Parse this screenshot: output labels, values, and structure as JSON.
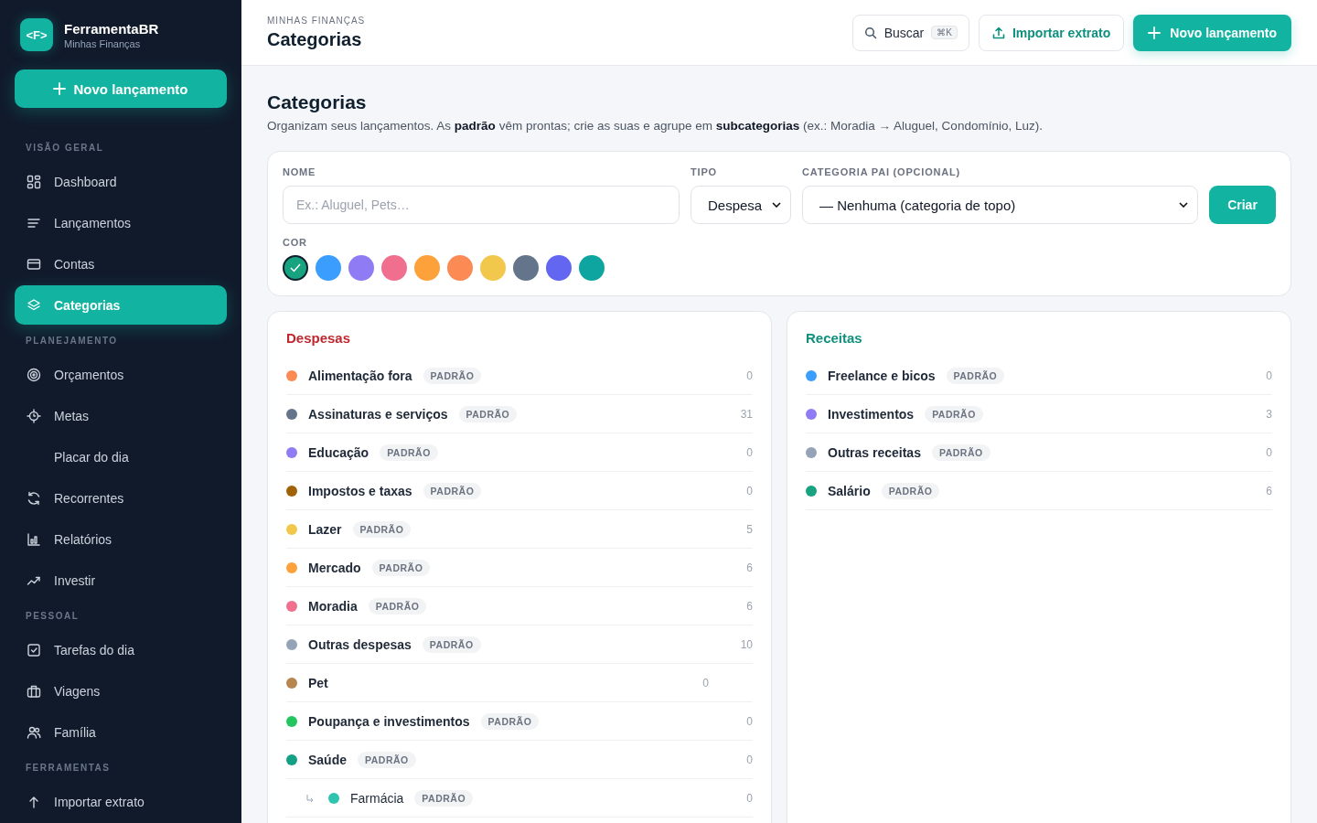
{
  "brand": {
    "logo": "<F>",
    "name": "FerramentaBR",
    "subtitle": "Minhas Finanças"
  },
  "sidebar": {
    "new_button": "Novo lançamento",
    "sections": [
      {
        "title": "VISÃO GERAL",
        "items": [
          {
            "label": "Dashboard",
            "selected": false
          },
          {
            "label": "Lançamentos",
            "selected": false
          },
          {
            "label": "Contas",
            "selected": false
          },
          {
            "label": "Categorias",
            "selected": true
          }
        ]
      },
      {
        "title": "PLANEJAMENTO",
        "items": [
          {
            "label": "Orçamentos",
            "selected": false
          },
          {
            "label": "Metas",
            "selected": false
          },
          {
            "label": "Placar do dia",
            "selected": false
          },
          {
            "label": "Recorrentes",
            "selected": false
          },
          {
            "label": "Relatórios",
            "selected": false
          },
          {
            "label": "Investir",
            "selected": false
          }
        ]
      },
      {
        "title": "PESSOAL",
        "items": [
          {
            "label": "Tarefas do dia",
            "selected": false
          },
          {
            "label": "Viagens",
            "selected": false
          },
          {
            "label": "Família",
            "selected": false
          }
        ]
      },
      {
        "title": "FERRAMENTAS",
        "items": [
          {
            "label": "Importar extrato",
            "selected": false
          }
        ]
      }
    ]
  },
  "header": {
    "breadcrumb": "MINHAS FINANÇAS",
    "title": "Categorias",
    "search": "Buscar",
    "shortcut": "⌘K",
    "import_button": "Importar extrato",
    "new_button": "Novo lançamento"
  },
  "page": {
    "title": "Categorias",
    "description": "Organizam seus lançamentos. As **padrão** vêm prontas; crie as suas e agrupe em **subcategorias** (ex.: Moradia → Aluguel, Condomínio, Luz)."
  },
  "form": {
    "name_label": "NOME",
    "name_placeholder": "Ex.: Aluguel, Pets…",
    "type_label": "TIPO",
    "type_value": "Despesa",
    "parent_label": "CATEGORIA PAI (OPCIONAL)",
    "parent_value": "— Nenhuma (categoria de topo)",
    "submit": "Criar",
    "color_label": "COR",
    "colors": [
      {
        "color": "#17a37f",
        "selected": true
      },
      {
        "color": "#3b9eff",
        "selected": false
      },
      {
        "color": "#8f7cf5",
        "selected": false
      },
      {
        "color": "#f06f8f",
        "selected": false
      },
      {
        "color": "#fda13a",
        "selected": false
      },
      {
        "color": "#fb8a55",
        "selected": false
      },
      {
        "color": "#f1c84b",
        "selected": false
      },
      {
        "color": "#64748b",
        "selected": false
      },
      {
        "color": "#6366f1",
        "selected": false
      },
      {
        "color": "#0ea5a0",
        "selected": false
      }
    ]
  },
  "groups": [
    {
      "kind": "expense",
      "title": "Despesas",
      "categories": [
        {
          "name": "Alimentação fora",
          "color": "#fb8a55",
          "badge": "PADRÃO",
          "count": "0"
        },
        {
          "name": "Assinaturas e serviços",
          "color": "#64748b",
          "badge": "PADRÃO",
          "count": "31"
        },
        {
          "name": "Educação",
          "color": "#8f7cf5",
          "badge": "PADRÃO",
          "count": "0"
        },
        {
          "name": "Impostos e taxas",
          "color": "#a16207",
          "badge": "PADRÃO",
          "count": "0"
        },
        {
          "name": "Lazer",
          "color": "#f1c84b",
          "badge": "PADRÃO",
          "count": "5"
        },
        {
          "name": "Mercado",
          "color": "#fda13a",
          "badge": "PADRÃO",
          "count": "6"
        },
        {
          "name": "Moradia",
          "color": "#f06f8f",
          "badge": "PADRÃO",
          "count": "6"
        },
        {
          "name": "Outras despesas",
          "color": "#94a3b8",
          "badge": "PADRÃO",
          "count": "10"
        },
        {
          "name": "Pet",
          "color": "#b7864e",
          "count": "0"
        },
        {
          "name": "Poupança e investimentos",
          "color": "#22c55e",
          "badge": "PADRÃO",
          "count": "0"
        },
        {
          "name": "Saúde",
          "color": "#14a085",
          "badge": "PADRÃO",
          "count": "0",
          "children": [
            {
              "name": "Farmácia",
              "color": "#2ec4b0",
              "badge": "PADRÃO",
              "count": "0"
            }
          ]
        }
      ]
    },
    {
      "kind": "income",
      "title": "Receitas",
      "categories": [
        {
          "name": "Freelance e bicos",
          "color": "#3b9eff",
          "badge": "PADRÃO",
          "count": "0"
        },
        {
          "name": "Investimentos",
          "color": "#8f7cf5",
          "badge": "PADRÃO",
          "count": "3"
        },
        {
          "name": "Outras receitas",
          "color": "#94a3b8",
          "badge": "PADRÃO",
          "count": "0"
        },
        {
          "name": "Salário",
          "color": "#17a37f",
          "badge": "PADRÃO",
          "count": "6"
        }
      ]
    }
  ]
}
